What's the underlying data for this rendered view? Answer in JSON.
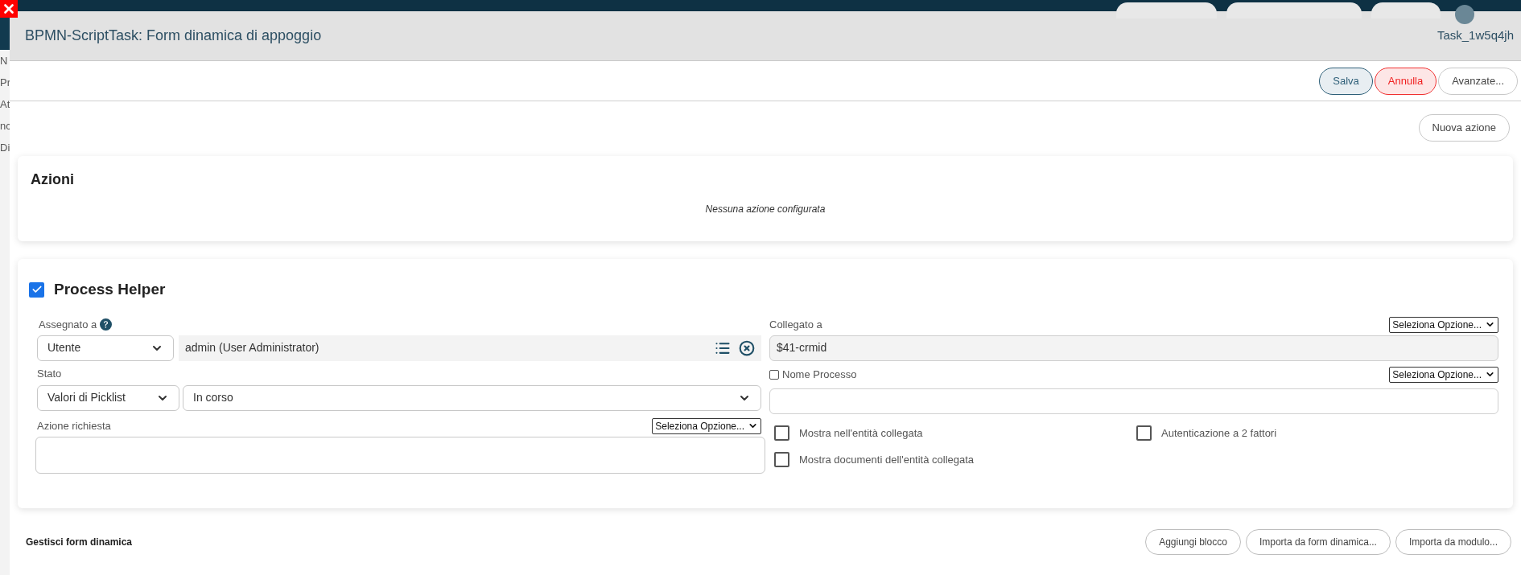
{
  "background_page": {
    "labels": [
      "N",
      "Pr",
      "At",
      "nc",
      "Di"
    ]
  },
  "dialog": {
    "title": "BPMN-ScriptTask: Form dinamica di appoggio",
    "task_id": "Task_1w5q4jh"
  },
  "toolbar": {
    "buttons": [
      {
        "label": "Salva",
        "kind": "primary"
      },
      {
        "label": "Annulla",
        "kind": "danger"
      },
      {
        "label": "Avanzate...",
        "kind": "default"
      }
    ]
  },
  "new_action_button": "Nuova azione",
  "actions_panel": {
    "title": "Azioni",
    "empty_message": "Nessuna azione configurata"
  },
  "process_helper": {
    "title": "Process Helper",
    "enabled": true,
    "assigned_to": {
      "label": "Assegnato a",
      "type": "Utente",
      "value": "admin (User Administrator)"
    },
    "status": {
      "label": "Stato",
      "source": "Valori di Picklist",
      "value": "In corso"
    },
    "required_action": {
      "label": "Azione richiesta",
      "option": "Seleziona Opzione..."
    },
    "linked_to": {
      "label": "Collegato a",
      "option": "Seleziona Opzione...",
      "value": "$41-crmid"
    },
    "process_name": {
      "label": "Nome Processo",
      "checked": false,
      "option": "Seleziona Opzione..."
    },
    "options": [
      {
        "label": "Mostra nell'entità collegata",
        "checked": false
      },
      {
        "label": "Autenticazione a 2 fattori",
        "checked": false
      },
      {
        "label": "Mostra documenti dell'entità collegata",
        "checked": false
      }
    ]
  },
  "dynamic_form": {
    "title": "Gestisci form dinamica",
    "buttons": [
      "Aggiungi blocco",
      "Importa da form dinamica...",
      "Importa da modulo..."
    ]
  }
}
